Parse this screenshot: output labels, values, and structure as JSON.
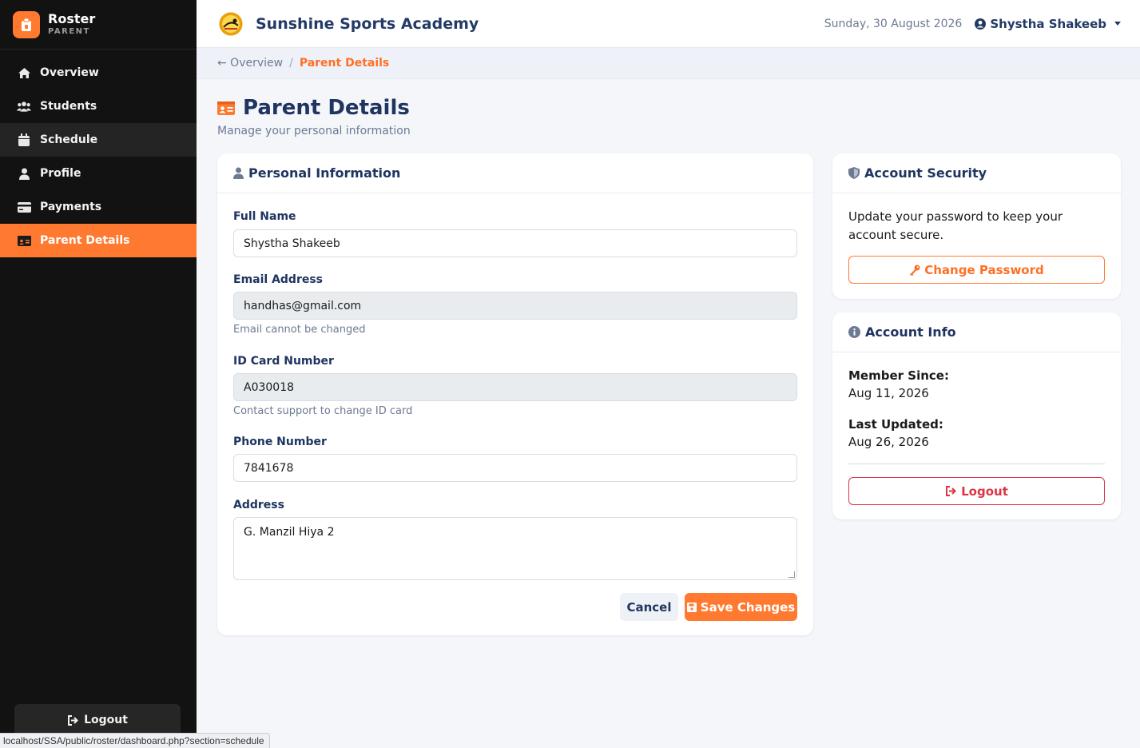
{
  "sidebar": {
    "brand_title": "Roster",
    "brand_sub": "PARENT",
    "items": [
      {
        "label": "Overview"
      },
      {
        "label": "Students"
      },
      {
        "label": "Schedule"
      },
      {
        "label": "Profile"
      },
      {
        "label": "Payments"
      },
      {
        "label": "Parent Details"
      }
    ],
    "logout_label": "Logout"
  },
  "header": {
    "academy_name": "Sunshine Sports Academy",
    "date": "Sunday, 30 August 2026",
    "user_name": "Shystha Shakeeb"
  },
  "breadcrumb": {
    "back_label": "← Overview",
    "separator": "/",
    "current": "Parent Details"
  },
  "page": {
    "title": "Parent Details",
    "subtitle": "Manage your personal information"
  },
  "personal_info": {
    "heading": "Personal Information",
    "full_name_label": "Full Name",
    "full_name_value": "Shystha Shakeeb",
    "email_label": "Email Address",
    "email_value": "handhas@gmail.com",
    "email_hint": "Email cannot be changed",
    "id_label": "ID Card Number",
    "id_value": "A030018",
    "id_hint": "Contact support to change ID card",
    "phone_label": "Phone Number",
    "phone_value": "7841678",
    "address_label": "Address",
    "address_value": "G. Manzil Hiya 2",
    "cancel_label": "Cancel",
    "save_label": "Save Changes"
  },
  "security": {
    "heading": "Account Security",
    "text": "Update your password to keep your account secure.",
    "button_label": "Change Password"
  },
  "account_info": {
    "heading": "Account Info",
    "member_since_label": "Member Since:",
    "member_since_value": "Aug 11, 2026",
    "last_updated_label": "Last Updated:",
    "last_updated_value": "Aug 26, 2026",
    "logout_label": "Logout"
  },
  "status_url": "localhost/SSA/public/roster/dashboard.php?section=schedule",
  "colors": {
    "accent": "#ff7a30",
    "sidebar_bg": "#121212",
    "navy": "#1f3460",
    "danger": "#dc3545"
  }
}
